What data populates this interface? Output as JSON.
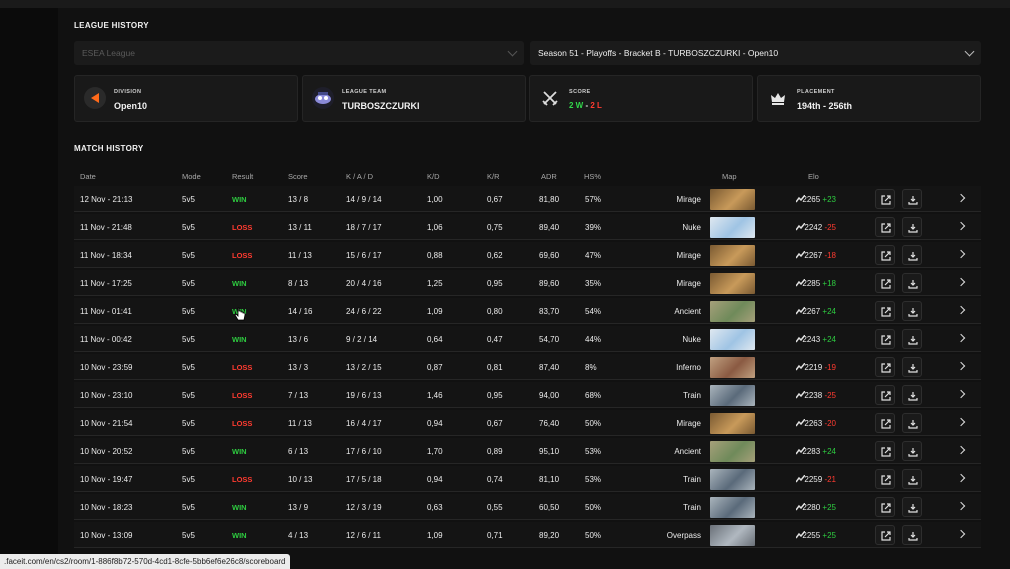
{
  "league_history": {
    "title": "LEAGUE HISTORY",
    "league_select": "ESEA League",
    "season_select": "Season 51 - Playoffs - Bracket B - TURBOSZCZURKI - Open10",
    "cards": [
      {
        "label": "DIVISION",
        "value": "Open10",
        "icon": "division-icon"
      },
      {
        "label": "LEAGUE TEAM",
        "value": "TURBOSZCZURKI",
        "icon": "team-logo-icon"
      },
      {
        "label": "SCORE",
        "wins": "2 W",
        "sep": " - ",
        "losses": "2 L",
        "icon": "crossed-swords-icon"
      },
      {
        "label": "PLACEMENT",
        "value": "194th - 256th",
        "icon": "crown-icon"
      }
    ]
  },
  "match_history": {
    "title": "MATCH HISTORY",
    "columns": [
      "Date",
      "Mode",
      "Result",
      "Score",
      "K / A / D",
      "K/D",
      "K/R",
      "ADR",
      "HS%",
      "Map",
      "Elo"
    ],
    "rows": [
      {
        "date": "12 Nov - 21:13",
        "mode": "5v5",
        "result": "WIN",
        "score": "13 / 8",
        "kad": "14 / 9 / 14",
        "kd": "1,00",
        "kr": "0,67",
        "adr": "81,80",
        "hs": "57%",
        "map": "Mirage",
        "elo": "2265",
        "delta": "+23"
      },
      {
        "date": "11 Nov - 21:48",
        "mode": "5v5",
        "result": "LOSS",
        "score": "13 / 11",
        "kad": "18 / 7 / 17",
        "kd": "1,06",
        "kr": "0,75",
        "adr": "89,40",
        "hs": "39%",
        "map": "Nuke",
        "elo": "2242",
        "delta": "-25"
      },
      {
        "date": "11 Nov - 18:34",
        "mode": "5v5",
        "result": "LOSS",
        "score": "11 / 13",
        "kad": "15 / 6 / 17",
        "kd": "0,88",
        "kr": "0,62",
        "adr": "69,60",
        "hs": "47%",
        "map": "Mirage",
        "elo": "2267",
        "delta": "-18"
      },
      {
        "date": "11 Nov - 17:25",
        "mode": "5v5",
        "result": "WIN",
        "score": "8 / 13",
        "kad": "20 / 4 / 16",
        "kd": "1,25",
        "kr": "0,95",
        "adr": "89,60",
        "hs": "35%",
        "map": "Mirage",
        "elo": "2285",
        "delta": "+18"
      },
      {
        "date": "11 Nov - 01:41",
        "mode": "5v5",
        "result": "WIN",
        "score": "14 / 16",
        "kad": "24 / 6 / 22",
        "kd": "1,09",
        "kr": "0,80",
        "adr": "83,70",
        "hs": "54%",
        "map": "Ancient",
        "elo": "2267",
        "delta": "+24"
      },
      {
        "date": "11 Nov - 00:42",
        "mode": "5v5",
        "result": "WIN",
        "score": "13 / 6",
        "kad": "9 / 2 / 14",
        "kd": "0,64",
        "kr": "0,47",
        "adr": "54,70",
        "hs": "44%",
        "map": "Nuke",
        "elo": "2243",
        "delta": "+24"
      },
      {
        "date": "10 Nov - 23:59",
        "mode": "5v5",
        "result": "LOSS",
        "score": "13 / 3",
        "kad": "13 / 2 / 15",
        "kd": "0,87",
        "kr": "0,81",
        "adr": "87,40",
        "hs": "8%",
        "map": "Inferno",
        "elo": "2219",
        "delta": "-19"
      },
      {
        "date": "10 Nov - 23:10",
        "mode": "5v5",
        "result": "LOSS",
        "score": "7 / 13",
        "kad": "19 / 6 / 13",
        "kd": "1,46",
        "kr": "0,95",
        "adr": "94,00",
        "hs": "68%",
        "map": "Train",
        "elo": "2238",
        "delta": "-25"
      },
      {
        "date": "10 Nov - 21:54",
        "mode": "5v5",
        "result": "LOSS",
        "score": "11 / 13",
        "kad": "16 / 4 / 17",
        "kd": "0,94",
        "kr": "0,67",
        "adr": "76,40",
        "hs": "50%",
        "map": "Mirage",
        "elo": "2263",
        "delta": "-20"
      },
      {
        "date": "10 Nov - 20:52",
        "mode": "5v5",
        "result": "WIN",
        "score": "6 / 13",
        "kad": "17 / 6 / 10",
        "kd": "1,70",
        "kr": "0,89",
        "adr": "95,10",
        "hs": "53%",
        "map": "Ancient",
        "elo": "2283",
        "delta": "+24"
      },
      {
        "date": "10 Nov - 19:47",
        "mode": "5v5",
        "result": "LOSS",
        "score": "10 / 13",
        "kad": "17 / 5 / 18",
        "kd": "0,94",
        "kr": "0,74",
        "adr": "81,10",
        "hs": "53%",
        "map": "Train",
        "elo": "2259",
        "delta": "-21"
      },
      {
        "date": "10 Nov - 18:23",
        "mode": "5v5",
        "result": "WIN",
        "score": "13 / 9",
        "kad": "12 / 3 / 19",
        "kd": "0,63",
        "kr": "0,55",
        "adr": "60,50",
        "hs": "50%",
        "map": "Train",
        "elo": "2280",
        "delta": "+25"
      },
      {
        "date": "10 Nov - 13:09",
        "mode": "5v5",
        "result": "WIN",
        "score": "4 / 13",
        "kad": "12 / 6 / 11",
        "kd": "1,09",
        "kr": "0,71",
        "adr": "89,20",
        "hs": "50%",
        "map": "Overpass",
        "elo": "2255",
        "delta": "+25"
      }
    ]
  },
  "status_bar_url": ".faceit.com/en/cs2/room/1-886f8b72-570d-4cd1-8cfe-5bb6ef6e26c8/scoreboard",
  "colors": {
    "win": "#2ecc40",
    "loss": "#ff3b30",
    "accent": "#ff5500",
    "background": "#111111"
  }
}
